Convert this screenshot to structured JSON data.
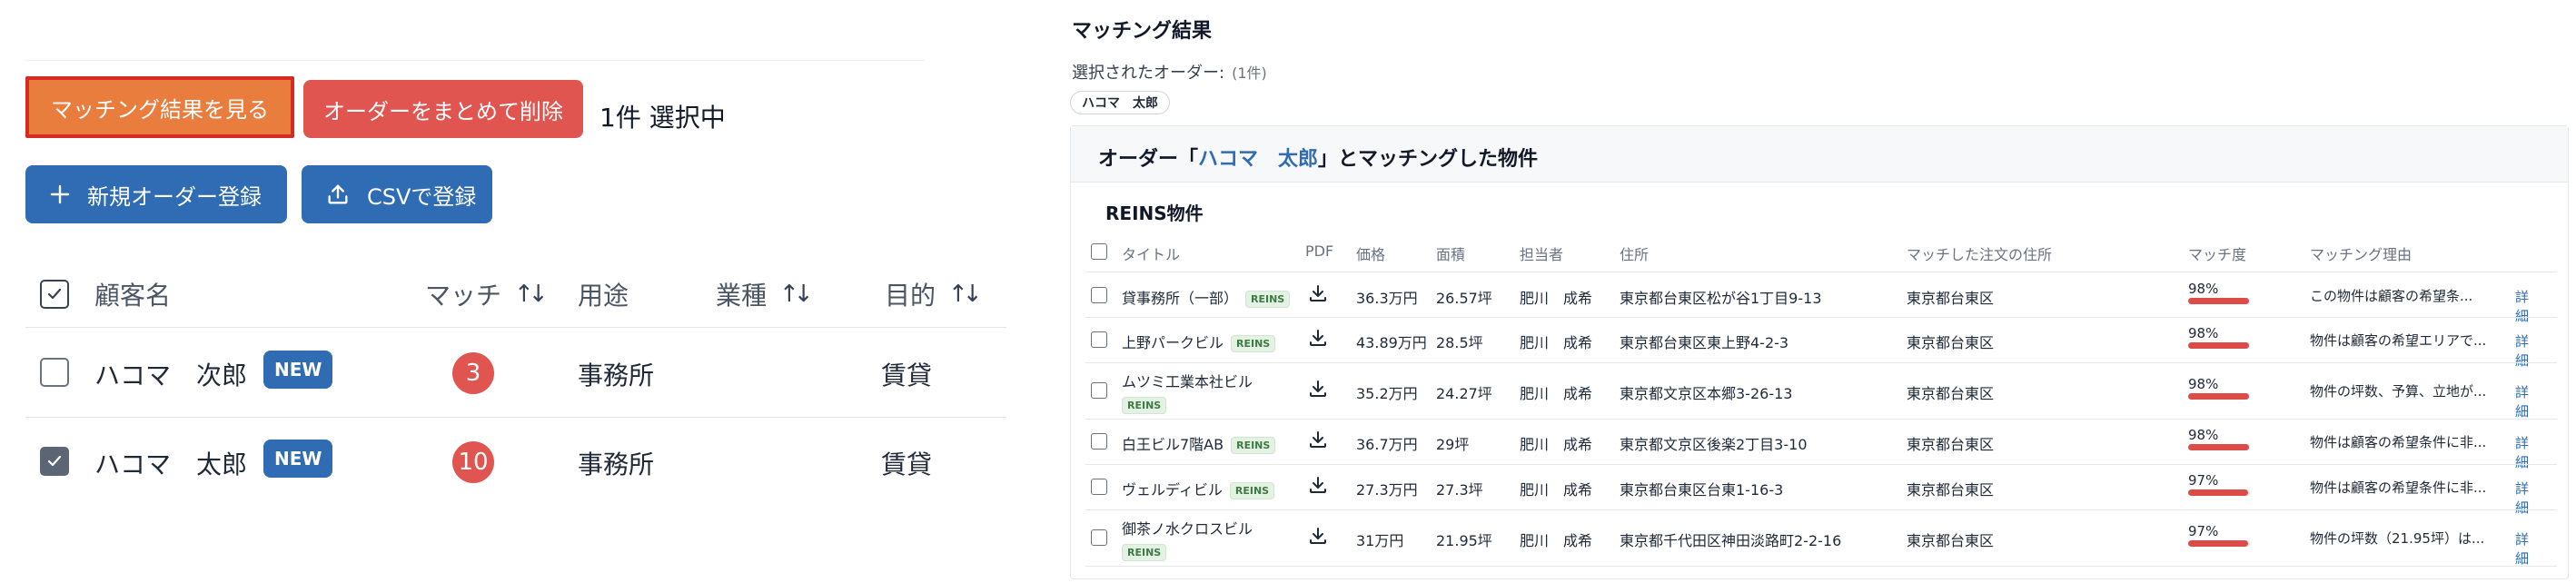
{
  "left": {
    "view_matching_button": "マッチング結果を見る",
    "bulk_delete_button": "オーダーをまとめて削除",
    "selection_count": "1件 選択中",
    "new_order_button": "新規オーダー登録",
    "csv_button": "CSVで登録",
    "columns": {
      "customer": "顧客名",
      "match": "マッチ",
      "usage": "用途",
      "industry": "業種",
      "purpose": "目的"
    },
    "rows": [
      {
        "name": "ハコマ　次郎",
        "badge": "NEW",
        "match": "3",
        "usage": "事務所",
        "purpose": "賃貸",
        "checked": false
      },
      {
        "name": "ハコマ　太郎",
        "badge": "NEW",
        "match": "10",
        "usage": "事務所",
        "purpose": "賃貸",
        "checked": true
      }
    ]
  },
  "right": {
    "title": "マッチング結果",
    "selected_label": "選択されたオーダー:",
    "selected_count": "(1件)",
    "selected_chip": "ハコマ　太郎",
    "card_title_prefix": "オーダー「",
    "card_title_name": "ハコマ　太郎",
    "card_title_suffix": "」とマッチングした物件",
    "section_title": "REINS物件",
    "columns": {
      "title": "タイトル",
      "pdf": "PDF",
      "price": "価格",
      "area": "面積",
      "agent": "担当者",
      "address": "住所",
      "matched_address": "マッチした注文の住所",
      "match_rate": "マッチ度",
      "reason": "マッチング理由"
    },
    "properties": [
      {
        "title": "貸事務所（一部）",
        "tag": "REINS",
        "price": "36.3万円",
        "area": "26.57坪",
        "agent": "肥川　成希",
        "address": "東京都台東区松が谷1丁目9-13",
        "matched_address": "東京都台東区",
        "match": "98%",
        "match_value": 98,
        "reason": "この物件は顧客の希望条...",
        "detail": "詳細"
      },
      {
        "title": "上野パークビル",
        "tag": "REINS",
        "price": "43.89万円",
        "area": "28.5坪",
        "agent": "肥川　成希",
        "address": "東京都台東区東上野4-2-3",
        "matched_address": "東京都台東区",
        "match": "98%",
        "match_value": 98,
        "reason": "物件は顧客の希望エリアで...",
        "detail": "詳細"
      },
      {
        "title": "ムツミ工業本社ビル",
        "tag": "REINS",
        "price": "35.2万円",
        "area": "24.27坪",
        "agent": "肥川　成希",
        "address": "東京都文京区本郷3-26-13",
        "matched_address": "東京都台東区",
        "match": "98%",
        "match_value": 98,
        "reason": "物件の坪数、予算、立地が...",
        "detail": "詳細"
      },
      {
        "title": "白王ビル7階AB",
        "tag": "REINS",
        "price": "36.7万円",
        "area": "29坪",
        "agent": "肥川　成希",
        "address": "東京都文京区後楽2丁目3-10",
        "matched_address": "東京都台東区",
        "match": "98%",
        "match_value": 98,
        "reason": "物件は顧客の希望条件に非...",
        "detail": "詳細"
      },
      {
        "title": "ヴェルディビル",
        "tag": "REINS",
        "price": "27.3万円",
        "area": "27.3坪",
        "agent": "肥川　成希",
        "address": "東京都台東区台東1-16-3",
        "matched_address": "東京都台東区",
        "match": "97%",
        "match_value": 97,
        "reason": "物件は顧客の希望条件に非...",
        "detail": "詳細"
      },
      {
        "title": "御茶ノ水クロスビル",
        "tag": "REINS",
        "price": "31万円",
        "area": "21.95坪",
        "agent": "肥川　成希",
        "address": "東京都千代田区神田淡路町2-2-16",
        "matched_address": "東京都台東区",
        "match": "97%",
        "match_value": 97,
        "reason": "物件の坪数（21.95坪）は...",
        "detail": "詳細"
      }
    ]
  }
}
